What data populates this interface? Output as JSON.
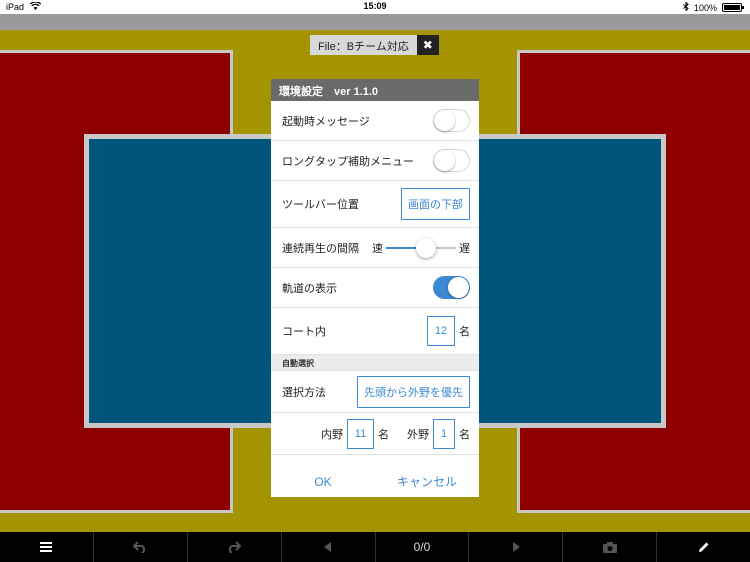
{
  "status_bar": {
    "device": "iPad",
    "time": "15:09",
    "battery": "100%",
    "battery_level": 1.0
  },
  "file_chip": {
    "label": "File：Bチーム対応",
    "close_icon": "close-icon"
  },
  "dialog": {
    "title": "環境設定　ver 1.1.0",
    "startup_message": {
      "label": "起動時メッセージ",
      "on": false
    },
    "longtap_menu": {
      "label": "ロングタップ補助メニュー",
      "on": false
    },
    "toolbar_position": {
      "label": "ツールバー位置",
      "value": "画面の下部"
    },
    "playback_interval": {
      "label": "連続再生の間隔",
      "fast": "速",
      "slow": "遅",
      "level": 0.57
    },
    "show_trajectory": {
      "label": "軌道の表示",
      "on": true
    },
    "in_court": {
      "label": "コート内",
      "value": "12",
      "unit": "名"
    },
    "section_auto_select": "自動選択",
    "select_method": {
      "label": "選択方法",
      "value": "先頭から外野を優先"
    },
    "infield": {
      "label": "内野",
      "value": "11",
      "unit": "名"
    },
    "outfield": {
      "label": "外野",
      "value": "1",
      "unit": "名"
    },
    "ok_label": "OK",
    "cancel_label": "キャンセル"
  },
  "toolbar": {
    "menu_icon": "hamburger-icon",
    "undo_icon": "undo-icon",
    "redo_icon": "redo-icon",
    "prev_icon": "prev-icon",
    "counter": "0/0",
    "next_icon": "next-icon",
    "camera_icon": "camera-icon",
    "pencil_icon": "pencil-icon"
  },
  "colors": {
    "court_yellow": "#a39400",
    "outfield_red": "#8e0000",
    "infield_blue": "#00567a",
    "accent_blue": "#3d88d2"
  }
}
